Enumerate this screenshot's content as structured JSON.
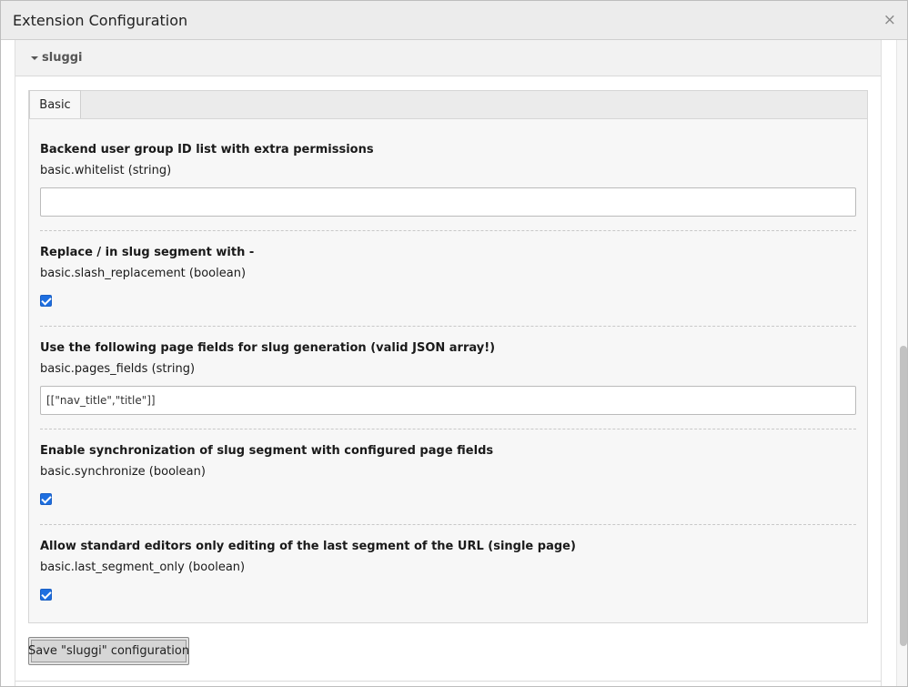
{
  "modal": {
    "title": "Extension Configuration",
    "close_label": "×"
  },
  "panel": {
    "title": "sluggi"
  },
  "tabs": [
    {
      "label": "Basic",
      "active": true
    }
  ],
  "fields": [
    {
      "label": "Backend user group ID list with extra permissions",
      "key": "basic.whitelist (string)",
      "type": "text",
      "value": ""
    },
    {
      "label": "Replace / in slug segment with -",
      "key": "basic.slash_replacement (boolean)",
      "type": "checkbox",
      "checked": true
    },
    {
      "label": "Use the following page fields for slug generation (valid JSON array!)",
      "key": "basic.pages_fields (string)",
      "type": "text",
      "value": "[[\"nav_title\",\"title\"]]"
    },
    {
      "label": "Enable synchronization of slug segment with configured page fields",
      "key": "basic.synchronize (boolean)",
      "type": "checkbox",
      "checked": true
    },
    {
      "label": "Allow standard editors only editing of the last segment of the URL (single page)",
      "key": "basic.last_segment_only (boolean)",
      "type": "checkbox",
      "checked": true
    }
  ],
  "save_button": {
    "label": "Save \"sluggi\" configuration"
  },
  "colors": {
    "accent": "#1e6fe0",
    "header_bg": "#ececec",
    "tab_content_bg": "#f7f7f7"
  }
}
